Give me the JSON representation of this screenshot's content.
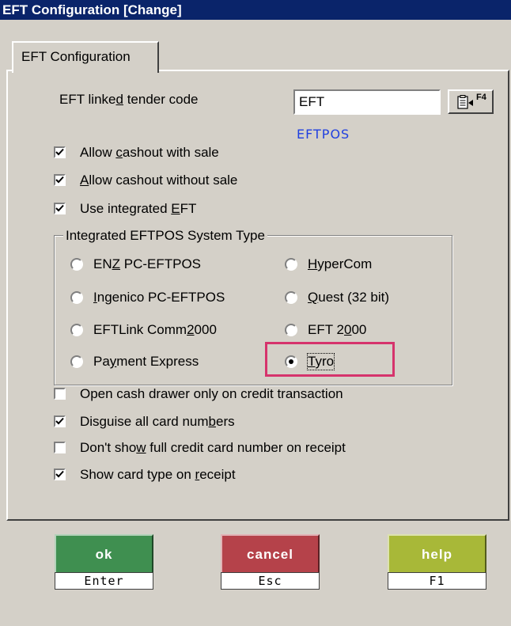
{
  "window": {
    "title": "EFT Configuration  [Change]"
  },
  "tab": {
    "label": "EFT Configuration"
  },
  "tender": {
    "label_pre": "EFT linke",
    "label_u": "d",
    "label_post": " tender code",
    "value": "EFT",
    "lookup_key": "F4",
    "description": "EFTPOS"
  },
  "options_top": [
    {
      "pre": "Allow ",
      "u": "c",
      "post": "ashout with sale",
      "checked": true
    },
    {
      "pre": "",
      "u": "A",
      "post": "llow cashout without sale",
      "checked": true
    },
    {
      "pre": "Use integrated ",
      "u": "E",
      "post": "FT",
      "checked": true
    }
  ],
  "system_type": {
    "title": "Integrated EFTPOS System Type",
    "options": [
      {
        "pre": "EN",
        "u": "Z",
        "post": " PC-EFTPOS",
        "selected": false
      },
      {
        "pre": "",
        "u": "H",
        "post": "yperCom",
        "selected": false
      },
      {
        "pre": "",
        "u": "I",
        "post": "ngenico PC-EFTPOS",
        "selected": false
      },
      {
        "pre": "",
        "u": "Q",
        "post": "uest (32 bit)",
        "selected": false
      },
      {
        "pre": "EFTLink Comm",
        "u": "2",
        "post": "000",
        "selected": false
      },
      {
        "pre": "EFT 2",
        "u": "0",
        "post": "00",
        "selected": false
      },
      {
        "pre": "Pa",
        "u": "y",
        "post": "ment Express",
        "selected": false
      },
      {
        "pre": "",
        "u": "T",
        "post": "yro",
        "selected": true
      }
    ]
  },
  "options_bottom": [
    {
      "pre": "Open cash drawer only on credit transaction",
      "u": "",
      "post": "",
      "checked": false
    },
    {
      "pre": "Disguise all card num",
      "u": "b",
      "post": "ers",
      "checked": true
    },
    {
      "pre": "Don't sho",
      "u": "w",
      "post": " full credit card number on receipt",
      "checked": false
    },
    {
      "pre": "Show card type on ",
      "u": "r",
      "post": "eceipt",
      "checked": true
    }
  ],
  "buttons": {
    "ok": {
      "label": "ok",
      "key": "Enter",
      "color": "#3f8f50"
    },
    "cancel": {
      "label": "cancel",
      "key": "Esc",
      "color": "#b5424a"
    },
    "help": {
      "label": "help",
      "key": "F1",
      "color": "#a8b838"
    }
  },
  "colors": {
    "highlight": "#d6336c",
    "title_bar": "#0a246a",
    "description": "#2040e0"
  }
}
